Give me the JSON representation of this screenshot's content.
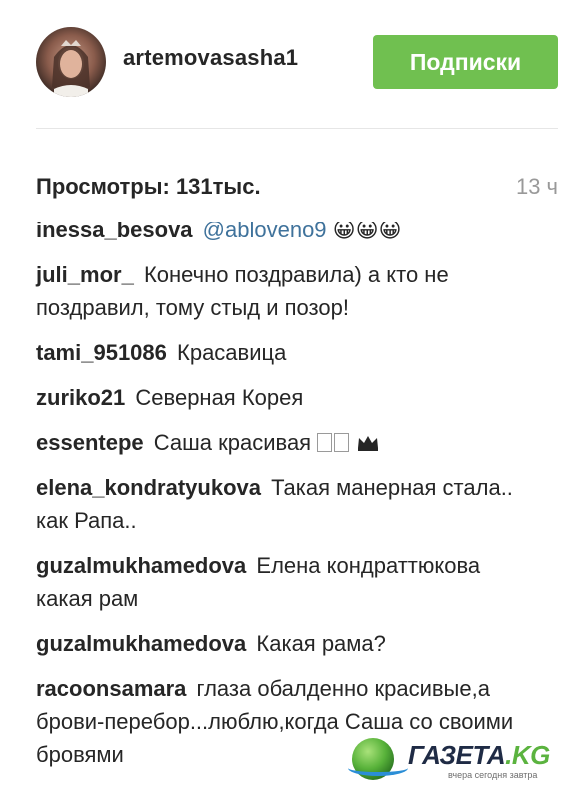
{
  "post_header": {
    "username": "artemovasasha1",
    "follow_button_label": "Подписки"
  },
  "stats": {
    "views_text": "Просмотры: 131тыс.",
    "time_ago": "13 ч"
  },
  "comments": [
    {
      "user": "inessa_besova",
      "mention": "@abloveno9",
      "text": "😀😀😀"
    },
    {
      "user": "juli_mor_",
      "text": "Конечно поздравила) а кто не поздравил, тому стыд и позор!"
    },
    {
      "user": "tami_951086",
      "text": "Красавица"
    },
    {
      "user": "zuriko21",
      "text": "Северная Корея"
    },
    {
      "user": "essentepe",
      "text": "Саша красивая"
    },
    {
      "user": "elena_kondratyukova",
      "text": "Такая манерная стала.. как Рапа.."
    },
    {
      "user": "guzalmukhamedova",
      "text": "Елена кондраттюкова какая рам"
    },
    {
      "user": "guzalmukhamedova",
      "text": "Какая рама?"
    },
    {
      "user": "racoonsamara",
      "text": "глаза обалденно красивые,а брови-перебор...люблю,когда Саша со своими бровями"
    }
  ],
  "watermark": {
    "brand": "ГАЗЕТА",
    "domain_suffix": ".KG",
    "tagline": "вчера сегодня завтра"
  },
  "colors": {
    "follow_button": "#70c050",
    "mention": "#3f729b",
    "time_ago": "#999999"
  }
}
